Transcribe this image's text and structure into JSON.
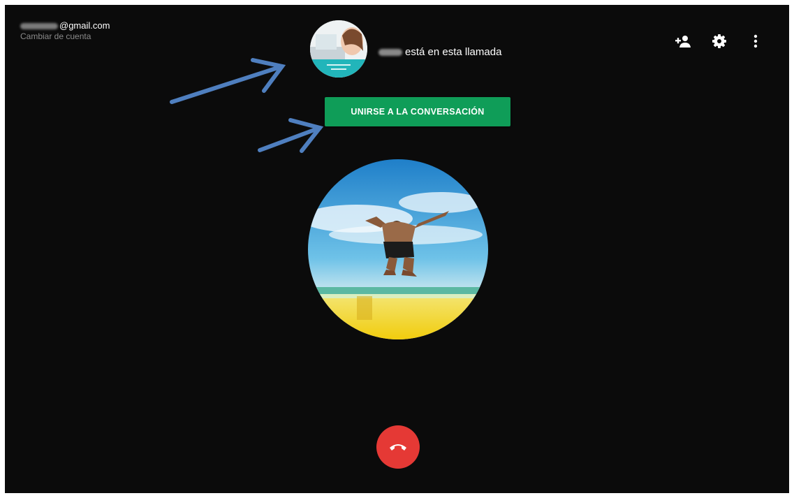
{
  "account": {
    "email_domain": "@gmail.com",
    "switch_label": "Cambiar de cuenta"
  },
  "caller": {
    "status_text": "está en esta llamada"
  },
  "join_button": {
    "label": "UNIRSE A LA CONVERSACIÓN"
  },
  "icons": {
    "add_person": "add-person-icon",
    "settings": "gear-icon",
    "more": "more-vert-icon",
    "hangup": "phone-hangup-icon"
  },
  "colors": {
    "background": "#0b0b0b",
    "join_button": "#0f9d58",
    "hangup_button": "#e53935",
    "annotation_arrow": "#4f7fbf"
  }
}
